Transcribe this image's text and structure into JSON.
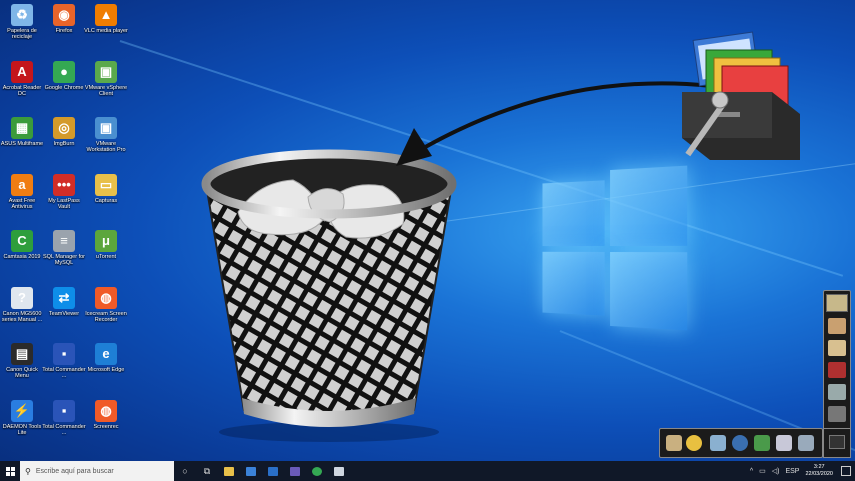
{
  "desktop": {
    "icons": [
      {
        "label": "Papelera de reciclaje",
        "icon": "recycle-bin-icon",
        "color": "#7fb6e8",
        "glyph": "♻"
      },
      {
        "label": "Firefox",
        "icon": "firefox-icon",
        "color": "#e8642a",
        "glyph": "◉"
      },
      {
        "label": "VLC media player",
        "icon": "vlc-icon",
        "color": "#f07d00",
        "glyph": "▲"
      },
      {
        "label": "Acrobat Reader DC",
        "icon": "acrobat-icon",
        "color": "#c4161c",
        "glyph": "A"
      },
      {
        "label": "Google Chrome",
        "icon": "chrome-icon",
        "color": "#34a853",
        "glyph": "●"
      },
      {
        "label": "VMware vSphere Client",
        "icon": "vmware-icon",
        "color": "#5aa94c",
        "glyph": "▣"
      },
      {
        "label": "ASUS Multiframe",
        "icon": "asus-icon",
        "color": "#3b9b3b",
        "glyph": "▦"
      },
      {
        "label": "ImgBurn",
        "icon": "imgburn-icon",
        "color": "#d49a2a",
        "glyph": "◎"
      },
      {
        "label": "VMware Workstation Pro",
        "icon": "vmware-workstation-icon",
        "color": "#4a8fd0",
        "glyph": "▣"
      },
      {
        "label": "Avast Free Antivirus",
        "icon": "avast-icon",
        "color": "#f07d12",
        "glyph": "a"
      },
      {
        "label": "My LastPass Vault",
        "icon": "lastpass-icon",
        "color": "#d22d27",
        "glyph": "•••"
      },
      {
        "label": "Capturas",
        "icon": "folder-icon",
        "color": "#e8c04a",
        "glyph": "▭"
      },
      {
        "label": "Camtasia 2019",
        "icon": "camtasia-icon",
        "color": "#2e9e3c",
        "glyph": "C"
      },
      {
        "label": "SQL Manager for MySQL",
        "icon": "sql-manager-icon",
        "color": "#9aa3ad",
        "glyph": "≡"
      },
      {
        "label": "uTorrent",
        "icon": "utorrent-icon",
        "color": "#5ca63c",
        "glyph": "μ"
      },
      {
        "label": "Canon MG5600 series Manual ...",
        "icon": "canon-manual-icon",
        "color": "#dfe6ee",
        "glyph": "?"
      },
      {
        "label": "TeamViewer",
        "icon": "teamviewer-icon",
        "color": "#0e8ee9",
        "glyph": "⇄"
      },
      {
        "label": "Icecream Screen Recorder",
        "icon": "icecream-icon",
        "color": "#f05a28",
        "glyph": "◍"
      },
      {
        "label": "Canon Quick Menu",
        "icon": "canon-quickmenu-icon",
        "color": "#2b2b2b",
        "glyph": "▤"
      },
      {
        "label": "Total Commander ...",
        "icon": "total-commander-icon",
        "color": "#2a54b8",
        "glyph": "▪"
      },
      {
        "label": "Microsoft Edge",
        "icon": "edge-icon",
        "color": "#1e7fd6",
        "glyph": "e"
      },
      {
        "label": "DAEMON Tools Lite",
        "icon": "daemon-tools-icon",
        "color": "#2a7de1",
        "glyph": "⚡"
      },
      {
        "label": "Total Commander ...",
        "icon": "total-commander-icon",
        "color": "#2a54b8",
        "glyph": "▪"
      },
      {
        "label": "Screenrec",
        "icon": "screenrec-icon",
        "color": "#f05a28",
        "glyph": "◍"
      }
    ]
  },
  "taskbar": {
    "search_placeholder": "Escribe aquí para buscar",
    "language": "ESP",
    "time": "3:27",
    "date": "22/03/2020"
  },
  "colors": {
    "taskbar_bg": "#101828",
    "wallpaper_accent": "#1a73d6"
  }
}
